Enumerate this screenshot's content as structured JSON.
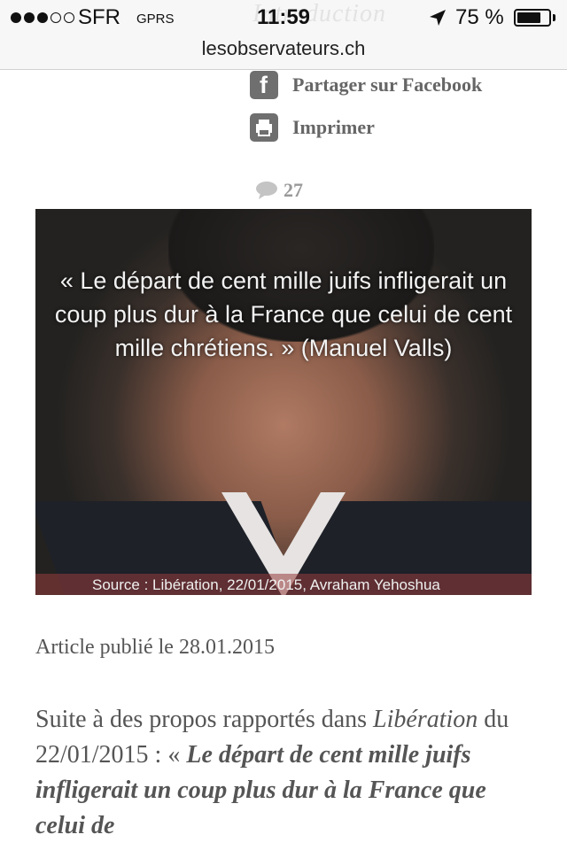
{
  "status_bar": {
    "carrier": "SFR",
    "network": "GPRS",
    "time": "11:59",
    "battery_percent": "75 %",
    "battery_level": 0.75,
    "ghost_text": "Introduction"
  },
  "url_bar": {
    "url": "lesobservateurs.ch"
  },
  "share": {
    "facebook_label": "Partager sur Facebook",
    "print_label": "Imprimer"
  },
  "comments": {
    "count": "27"
  },
  "photo": {
    "quote": "« Le départ de cent mille juifs infligerait un coup plus dur à la France que celui de cent mille chrétiens. » (Manuel Valls)",
    "source": "Source : Libération, 22/01/2015, Avraham Yehoshua"
  },
  "article": {
    "published": "Article publié le 28.01.2015",
    "body_intro": "Suite à des propos rapportés dans ",
    "body_source": "Libération",
    "body_date": " du 22/01/2015 : « ",
    "body_quote": "Le départ de cent mille juifs infligerait un coup plus dur à la France que celui de"
  }
}
